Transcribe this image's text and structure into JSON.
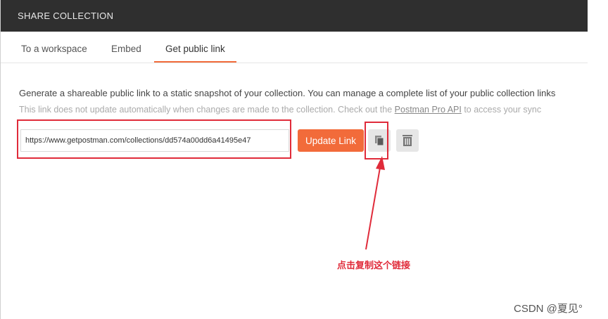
{
  "dialog": {
    "title": "SHARE COLLECTION",
    "tabs": [
      {
        "label": "To a workspace"
      },
      {
        "label": "Embed"
      },
      {
        "label": "Get public link",
        "active": true
      }
    ],
    "description": "Generate a shareable public link to a static snapshot of your collection. You can manage a complete list of your public collection links",
    "note_prefix": "This link does not update automatically when changes are made to the collection. Check out the ",
    "note_link": "Postman Pro API",
    "note_suffix": " to access your sync",
    "link_value": "https://www.getpostman.com/collections/dd574a00dd6a41495e47",
    "update_button": "Update Link",
    "copy_icon": "copy-icon",
    "delete_icon": "trash-icon",
    "accent_color": "#f26b3a"
  },
  "annotation": {
    "text": "点击复制这个链接",
    "color": "#e02b3a"
  },
  "watermark": "CSDN @夏见°"
}
